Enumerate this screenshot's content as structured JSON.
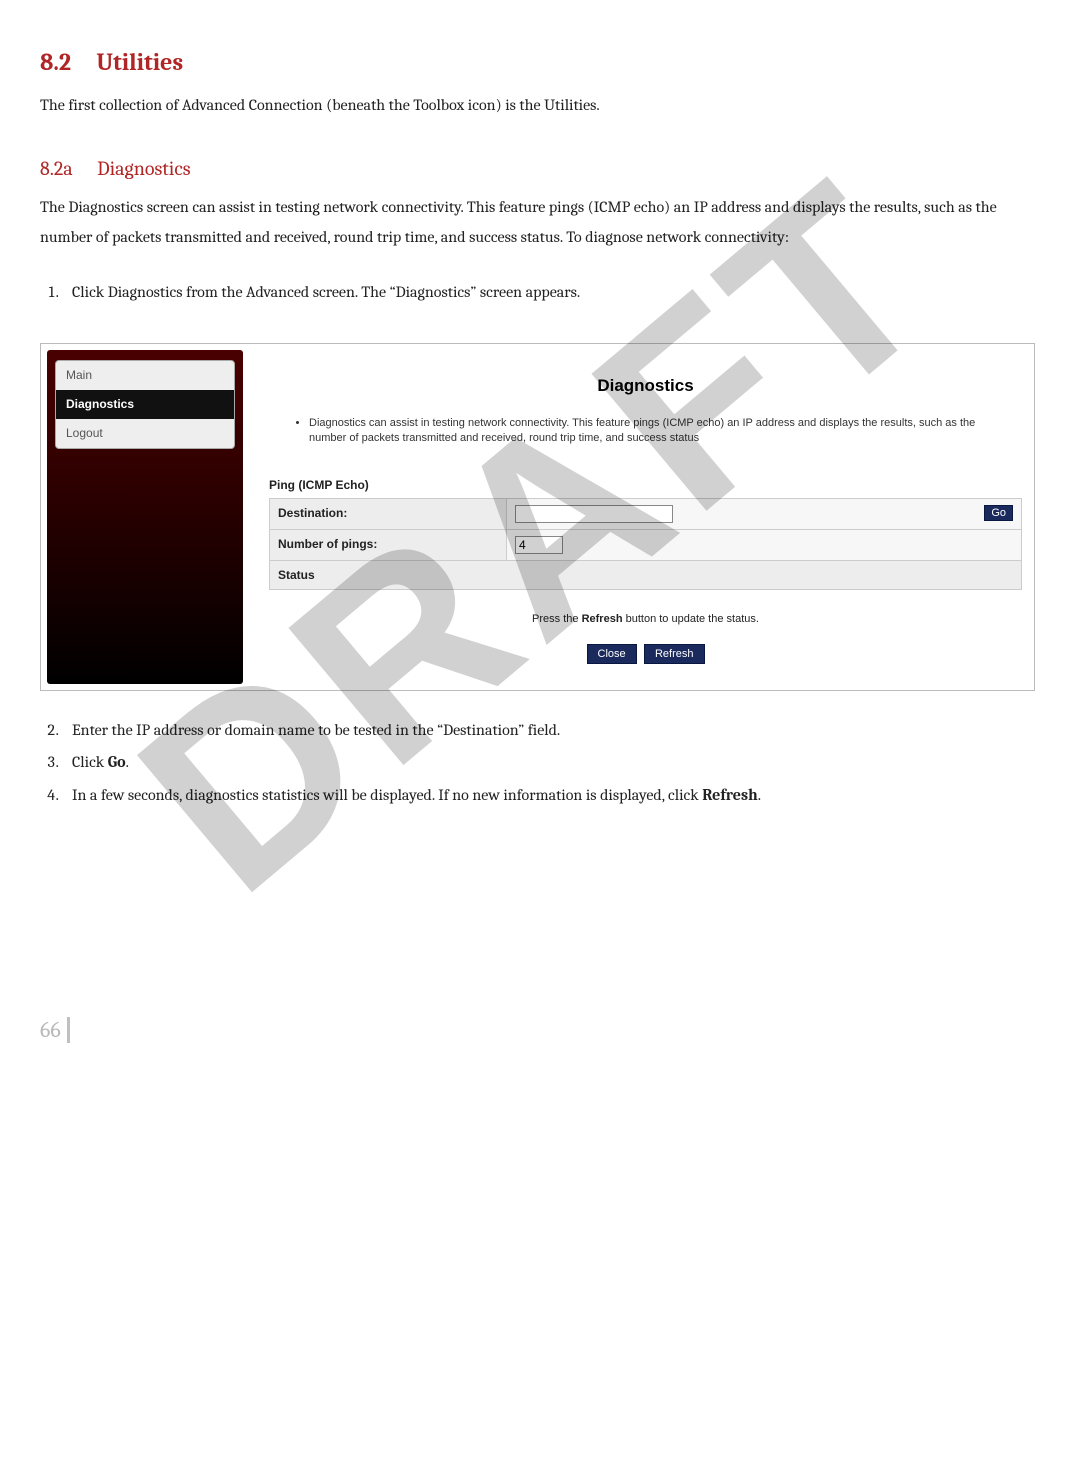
{
  "section": {
    "num": "8.2",
    "title": "Utilities"
  },
  "section_intro": "The first collection of Advanced Connection (beneath the Toolbox icon) is the Utilities.",
  "subsection": {
    "num": "8.2a",
    "title": "Diagnostics"
  },
  "subsection_intro": "The Diagnostics screen can assist in testing network connectivity. This feature pings (ICMP echo) an IP address and displays the results, such as the number of packets transmitted and received, round trip time, and success status. To diagnose network connectivity:",
  "steps_before": [
    "Click Diagnostics from the Advanced screen. The “Diagnostics” screen appears."
  ],
  "steps_after": [
    {
      "pre": "Enter the IP address or domain name to be tested in the “Destination” field."
    },
    {
      "pre": "Click ",
      "bold": "Go",
      "post": "."
    },
    {
      "pre": "In a few seconds, diagnostics statistics will be displayed. If no new information is displayed, click ",
      "bold": "Refresh",
      "post": "."
    }
  ],
  "screenshot": {
    "nav": [
      "Main",
      "Diagnostics",
      "Logout"
    ],
    "nav_active_index": 1,
    "heading": "Diagnostics",
    "desc": "Diagnostics can assist in testing network connectivity. This feature pings (ICMP echo) an IP address and displays the results, such as the number of packets transmitted and received, round trip time, and success status",
    "form_title": "Ping (ICMP Echo)",
    "dest_label": "Destination:",
    "dest_value": "",
    "go_label": "Go",
    "pings_label": "Number of pings:",
    "pings_value": "4",
    "status_label": "Status",
    "refresh_note_pre": "Press the ",
    "refresh_note_bold": "Refresh",
    "refresh_note_post": " button to update the status.",
    "close_label": "Close",
    "refresh_label": "Refresh"
  },
  "page_number": "66"
}
